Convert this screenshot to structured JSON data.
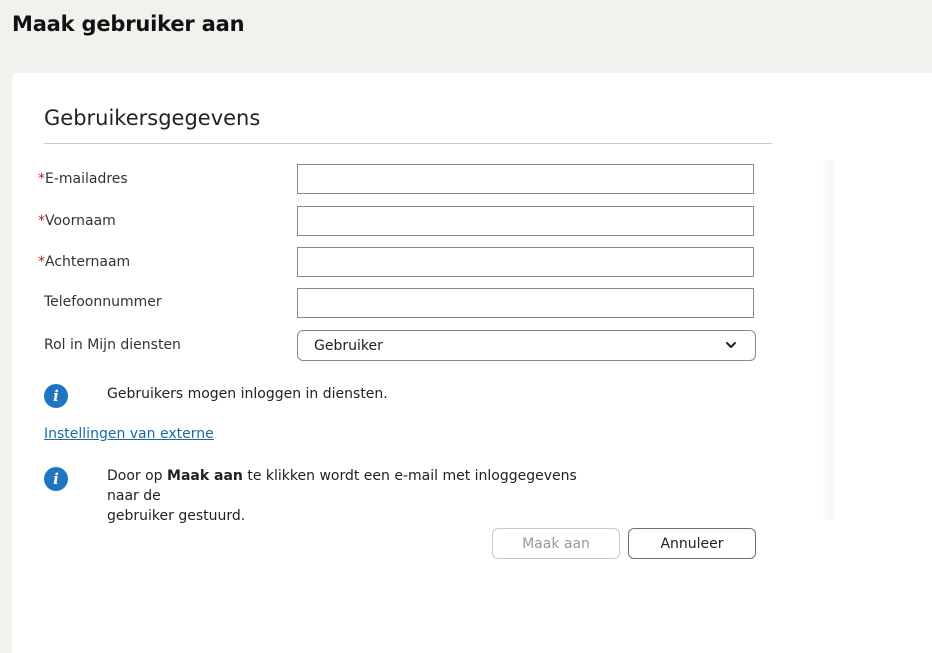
{
  "header": {
    "title": "Maak gebruiker aan"
  },
  "form": {
    "section_title": "Gebruikersgegevens",
    "required_marker": "*",
    "fields": [
      {
        "label": "E-mailadres",
        "required": true,
        "value": ""
      },
      {
        "label": "Voornaam",
        "required": true,
        "value": ""
      },
      {
        "label": "Achternaam",
        "required": true,
        "value": ""
      },
      {
        "label": "Telefoonnummer",
        "required": false,
        "value": ""
      }
    ],
    "role": {
      "label": "Rol in Mijn diensten",
      "selected": "Gebruiker"
    },
    "info_role": "Gebruikers mogen inloggen in diensten.",
    "external_link": "Instellingen van externe",
    "info_create": {
      "prefix": "Door op ",
      "bold": "Maak aan",
      "line1_suffix": " te klikken wordt een e-mail met inloggegevens naar de",
      "line2": "gebruiker gestuurd."
    }
  },
  "buttons": {
    "create": "Maak aan",
    "cancel": "Annuleer"
  },
  "colors": {
    "background": "#f3f1ee",
    "info_icon": "#1f75c2",
    "required": "#b62020",
    "link": "#1a6aa3"
  },
  "icons": {
    "info": "info-icon",
    "dropdown": "chevron-down-icon"
  }
}
